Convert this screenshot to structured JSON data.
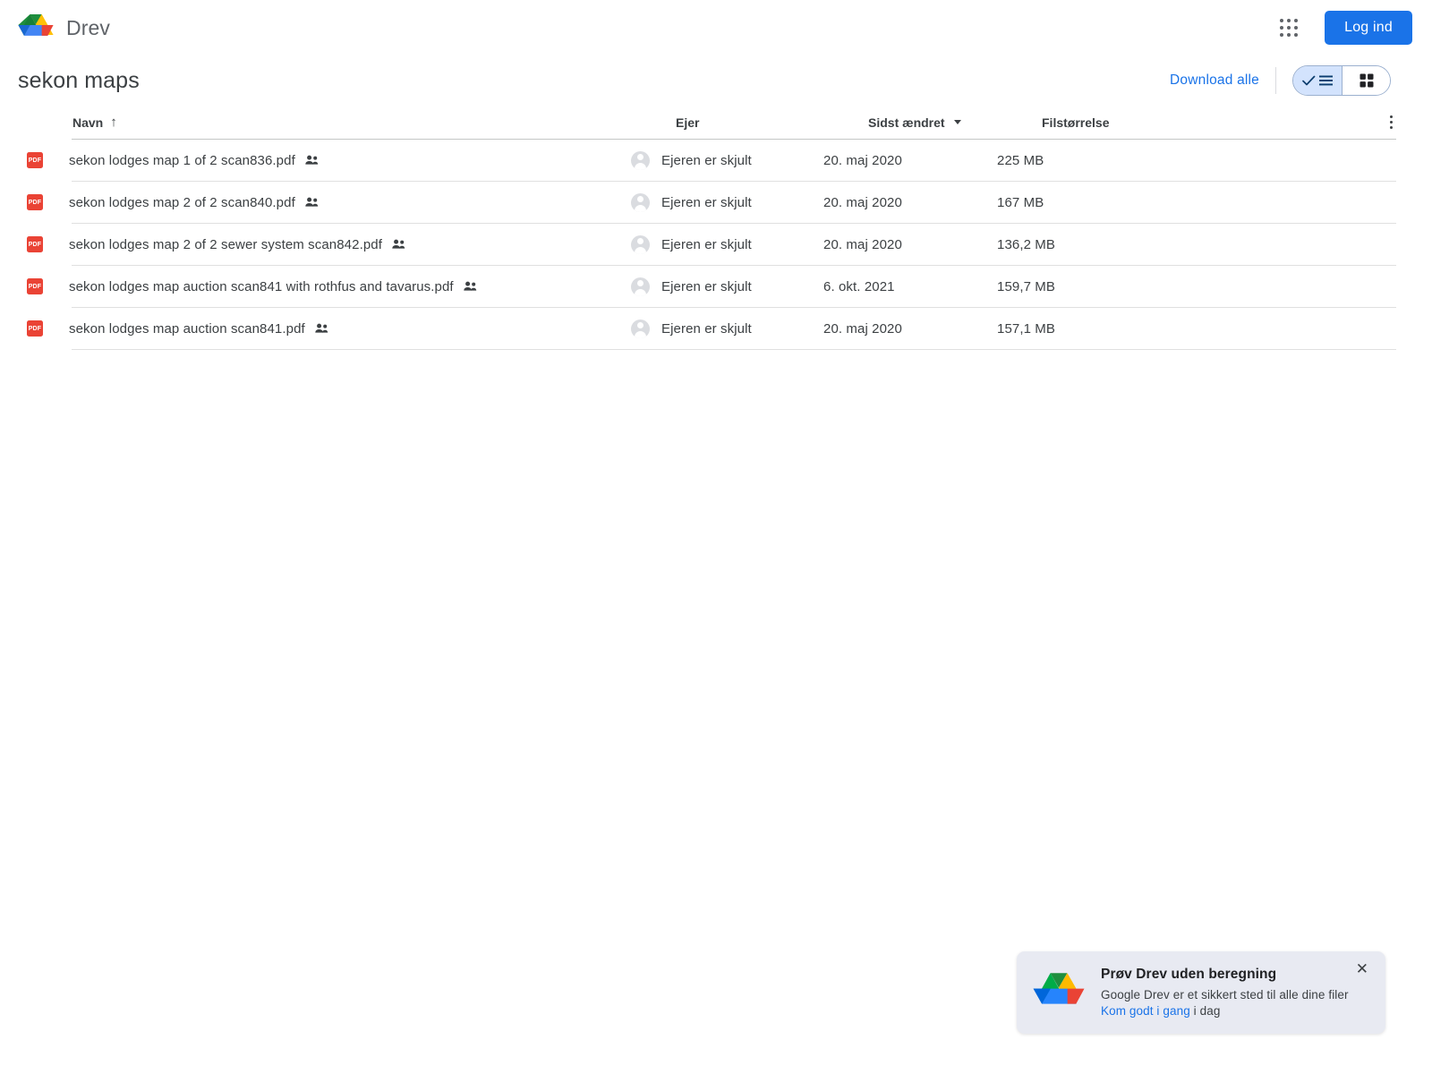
{
  "topbar": {
    "brand_name": "Drev",
    "logo_icon": "google-drive-logo",
    "apps_icon": "apps-grid-icon",
    "login_label": "Log ind"
  },
  "folder": {
    "title": "sekon maps",
    "download_all_label": "Download alle",
    "view_list_icon": "list-view-icon",
    "view_grid_icon": "grid-view-icon",
    "active_view": "list"
  },
  "table": {
    "headers": {
      "name": "Navn",
      "owner": "Ejer",
      "modified": "Sidst ændret",
      "size": "Filstørrelse"
    },
    "sort_arrow": "↑",
    "kebab_icon": "more-options-icon",
    "rows": [
      {
        "file_type_icon": "pdf-icon",
        "file_type_label": "PDF",
        "name": "sekon lodges map 1 of 2 scan836.pdf",
        "shared_icon": "shared-people-icon",
        "owner_avatar_icon": "person-avatar-icon",
        "owner": "Ejeren er skjult",
        "modified": "20. maj 2020",
        "size": "225 MB"
      },
      {
        "file_type_icon": "pdf-icon",
        "file_type_label": "PDF",
        "name": "sekon lodges map 2 of 2 scan840.pdf",
        "shared_icon": "shared-people-icon",
        "owner_avatar_icon": "person-avatar-icon",
        "owner": "Ejeren er skjult",
        "modified": "20. maj 2020",
        "size": "167 MB"
      },
      {
        "file_type_icon": "pdf-icon",
        "file_type_label": "PDF",
        "name": "sekon lodges map 2 of 2 sewer system scan842.pdf",
        "shared_icon": "shared-people-icon",
        "owner_avatar_icon": "person-avatar-icon",
        "owner": "Ejeren er skjult",
        "modified": "20. maj 2020",
        "size": "136,2 MB"
      },
      {
        "file_type_icon": "pdf-icon",
        "file_type_label": "PDF",
        "name": "sekon lodges map auction scan841 with rothfus and tavarus.pdf",
        "shared_icon": "shared-people-icon",
        "owner_avatar_icon": "person-avatar-icon",
        "owner": "Ejeren er skjult",
        "modified": "6. okt. 2021",
        "size": "159,7 MB"
      },
      {
        "file_type_icon": "pdf-icon",
        "file_type_label": "PDF",
        "name": "sekon lodges map auction scan841.pdf",
        "shared_icon": "shared-people-icon",
        "owner_avatar_icon": "person-avatar-icon",
        "owner": "Ejeren er skjult",
        "modified": "20. maj 2020",
        "size": "157,1 MB"
      }
    ]
  },
  "promo": {
    "logo_icon": "google-drive-logo",
    "title": "Prøv Drev uden beregning",
    "body": "Google Drev er et sikkert sted til alle dine filer",
    "link_label": "Kom godt i gang",
    "link_suffix": " i dag",
    "close_icon": "close-icon",
    "close_label": "✕"
  },
  "colors": {
    "accent_blue": "#1a73e8",
    "pdf_red": "#ea4335",
    "toggle_active": "#d3e3fd",
    "promo_bg": "#e8eaf2",
    "text_primary": "#3c4043"
  }
}
